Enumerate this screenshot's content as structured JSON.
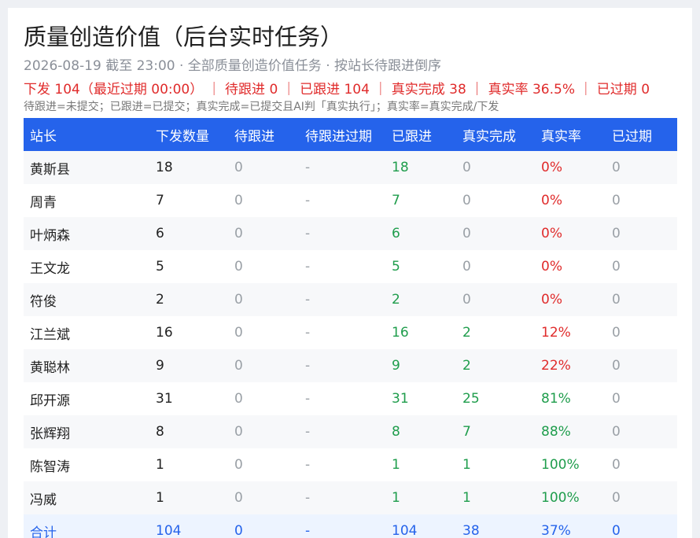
{
  "header": {
    "title": "质量创造价值（后台实时任务）",
    "subtitle": "2026-08-19 截至 23:00 · 全部质量创造价值任务 · 按站长待跟进倒序",
    "summary": "下发 104（最近过期 00:00） ｜ 待跟进 0 ｜ 已跟进 104 ｜ 真实完成 38 ｜ 真实率 36.5% ｜ 已过期 0",
    "note": "待跟进=未提交；已跟进=已提交；真实完成=已提交且AI判「真实执行」；真实率=真实完成/下发"
  },
  "colors": {
    "header_bg": "#2563eb",
    "green": "#1f9d4c",
    "red": "#e02b2b",
    "gray": "#9aa0a6",
    "total_bg": "#edf4ff"
  },
  "table": {
    "columns": [
      "站长",
      "下发数量",
      "待跟进",
      "待跟进过期",
      "已跟进",
      "真实完成",
      "真实率",
      "已过期"
    ],
    "rows": [
      {
        "name": "黄斯县",
        "issued": "18",
        "pending": "0",
        "pending_overdue": "-",
        "followed": "18",
        "real_done": "0",
        "real_rate": "0%",
        "expired": "0"
      },
      {
        "name": "周青",
        "issued": "7",
        "pending": "0",
        "pending_overdue": "-",
        "followed": "7",
        "real_done": "0",
        "real_rate": "0%",
        "expired": "0"
      },
      {
        "name": "叶炳森",
        "issued": "6",
        "pending": "0",
        "pending_overdue": "-",
        "followed": "6",
        "real_done": "0",
        "real_rate": "0%",
        "expired": "0"
      },
      {
        "name": "王文龙",
        "issued": "5",
        "pending": "0",
        "pending_overdue": "-",
        "followed": "5",
        "real_done": "0",
        "real_rate": "0%",
        "expired": "0"
      },
      {
        "name": "符俊",
        "issued": "2",
        "pending": "0",
        "pending_overdue": "-",
        "followed": "2",
        "real_done": "0",
        "real_rate": "0%",
        "expired": "0"
      },
      {
        "name": "江兰斌",
        "issued": "16",
        "pending": "0",
        "pending_overdue": "-",
        "followed": "16",
        "real_done": "2",
        "real_rate": "12%",
        "expired": "0"
      },
      {
        "name": "黄聪林",
        "issued": "9",
        "pending": "0",
        "pending_overdue": "-",
        "followed": "9",
        "real_done": "2",
        "real_rate": "22%",
        "expired": "0"
      },
      {
        "name": "邱开源",
        "issued": "31",
        "pending": "0",
        "pending_overdue": "-",
        "followed": "31",
        "real_done": "25",
        "real_rate": "81%",
        "expired": "0"
      },
      {
        "name": "张辉翔",
        "issued": "8",
        "pending": "0",
        "pending_overdue": "-",
        "followed": "8",
        "real_done": "7",
        "real_rate": "88%",
        "expired": "0"
      },
      {
        "name": "陈智涛",
        "issued": "1",
        "pending": "0",
        "pending_overdue": "-",
        "followed": "1",
        "real_done": "1",
        "real_rate": "100%",
        "expired": "0"
      },
      {
        "name": "冯威",
        "issued": "1",
        "pending": "0",
        "pending_overdue": "-",
        "followed": "1",
        "real_done": "1",
        "real_rate": "100%",
        "expired": "0"
      }
    ],
    "total": {
      "name": "合计",
      "issued": "104",
      "pending": "0",
      "pending_overdue": "-",
      "followed": "104",
      "real_done": "38",
      "real_rate": "37%",
      "expired": "0"
    }
  }
}
